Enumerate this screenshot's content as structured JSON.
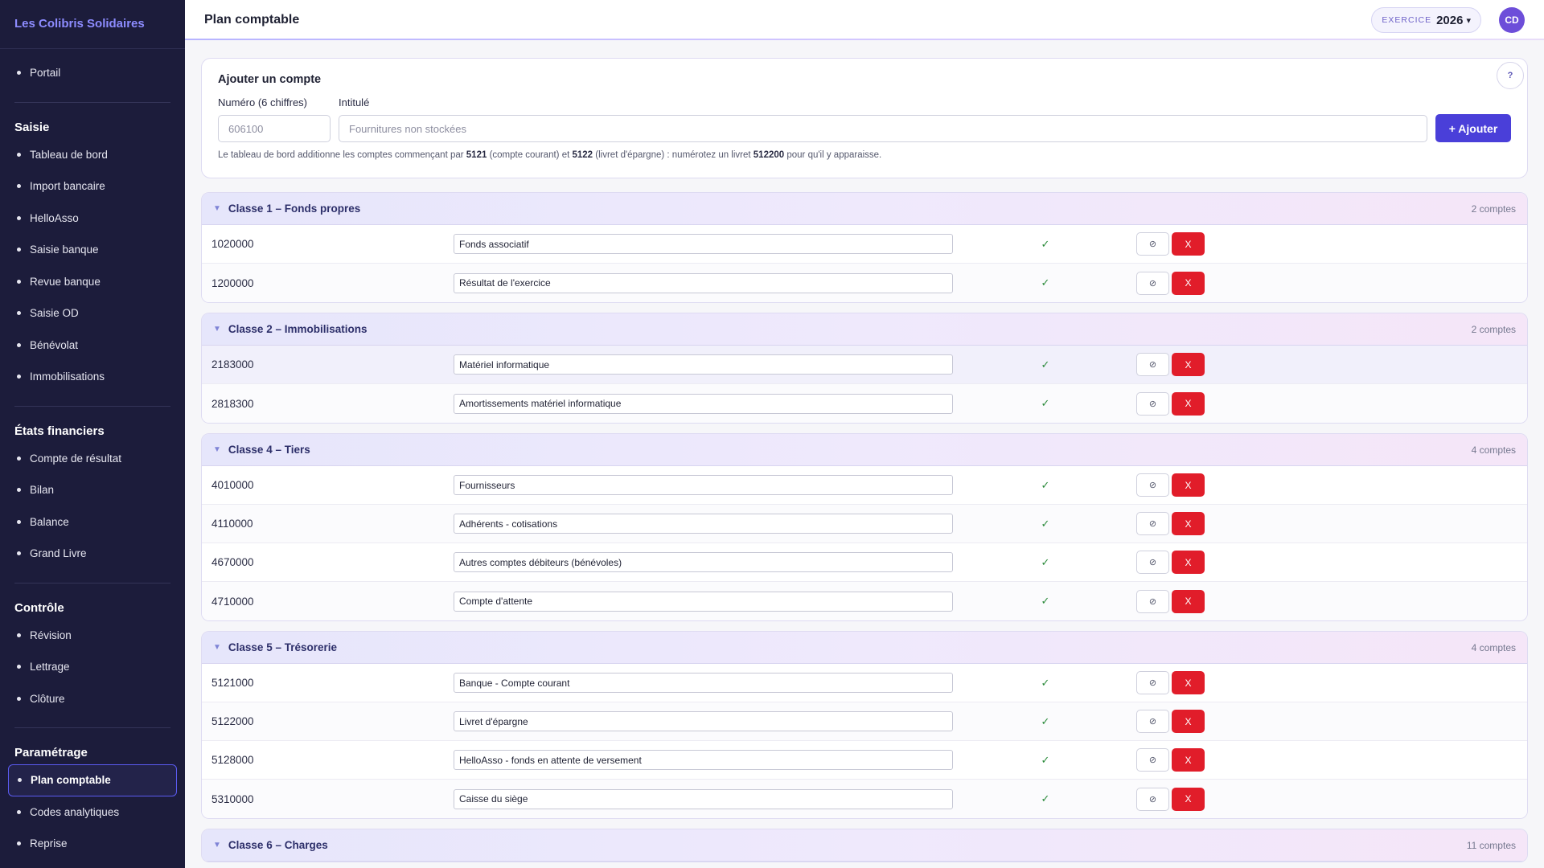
{
  "org_name": "Les Colibris Solidaires",
  "nav": {
    "portal": "Portail",
    "sections": [
      {
        "title": "Saisie",
        "items": [
          "Tableau de bord",
          "Import bancaire",
          "HelloAsso",
          "Saisie banque",
          "Revue banque",
          "Saisie OD",
          "Bénévolat",
          "Immobilisations"
        ]
      },
      {
        "title": "États financiers",
        "items": [
          "Compte de résultat",
          "Bilan",
          "Balance",
          "Grand Livre"
        ]
      },
      {
        "title": "Contrôle",
        "items": [
          "Révision",
          "Lettrage",
          "Clôture"
        ]
      },
      {
        "title": "Paramétrage",
        "items": [
          "Plan comptable",
          "Codes analytiques",
          "Reprise"
        ]
      }
    ],
    "active": "Plan comptable"
  },
  "topbar": {
    "title": "Plan comptable",
    "exercise_label": "EXERCICE",
    "exercise_year": "2026",
    "avatar_initials": "CD"
  },
  "add_account": {
    "title": "Ajouter un compte",
    "help": "?",
    "number_label": "Numéro (6 chiffres)",
    "number_placeholder": "606100",
    "label_label": "Intitulé",
    "label_placeholder": "Fournitures non stockées",
    "add_button": "+ Ajouter",
    "hint": {
      "p1": "Le tableau de bord additionne les comptes commençant par ",
      "b1": "5121",
      "p2": " (compte courant) et ",
      "b2": "5122",
      "p3": " (livret d'épargne) : numérotez un livret ",
      "b3": "512200",
      "p4": " pour qu'il y apparaisse."
    }
  },
  "classes": [
    {
      "title": "Classe 1 – Fonds propres",
      "count": "2 comptes",
      "accounts": [
        {
          "number": "1020000",
          "label": "Fonds associatif"
        },
        {
          "number": "1200000",
          "label": "Résultat de l'exercice"
        }
      ]
    },
    {
      "title": "Classe 2 – Immobilisations",
      "count": "2 comptes",
      "accounts": [
        {
          "number": "2183000",
          "label": "Matériel informatique"
        },
        {
          "number": "2818300",
          "label": "Amortissements matériel informatique"
        }
      ]
    },
    {
      "title": "Classe 4 – Tiers",
      "count": "4 comptes",
      "accounts": [
        {
          "number": "4010000",
          "label": "Fournisseurs"
        },
        {
          "number": "4110000",
          "label": "Adhérents - cotisations"
        },
        {
          "number": "4670000",
          "label": "Autres comptes débiteurs (bénévoles)"
        },
        {
          "number": "4710000",
          "label": "Compte d'attente"
        }
      ]
    },
    {
      "title": "Classe 5 – Trésorerie",
      "count": "4 comptes",
      "accounts": [
        {
          "number": "5121000",
          "label": "Banque - Compte courant"
        },
        {
          "number": "5122000",
          "label": "Livret d'épargne"
        },
        {
          "number": "5128000",
          "label": "HelloAsso - fonds en attente de versement"
        },
        {
          "number": "5310000",
          "label": "Caisse du siège"
        }
      ]
    },
    {
      "title": "Classe 6 – Charges",
      "count": "11 comptes",
      "accounts": []
    }
  ],
  "row_symbols": {
    "check": "✓",
    "pause": "⊘",
    "delete": "X"
  }
}
